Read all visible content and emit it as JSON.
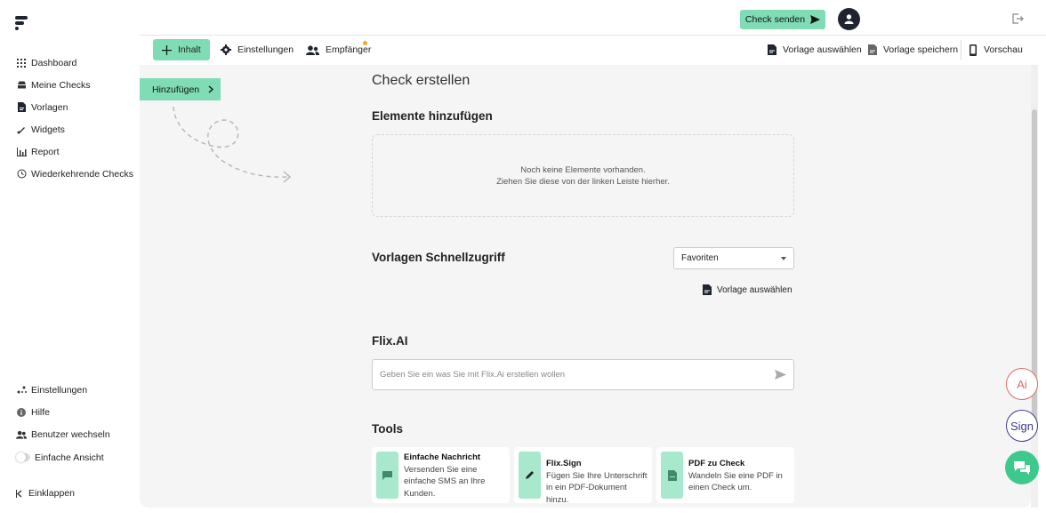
{
  "sidebar": {
    "items": [
      {
        "label": "Dashboard",
        "icon": "grid-icon"
      },
      {
        "label": "Meine Checks",
        "icon": "inbox-icon"
      },
      {
        "label": "Vorlagen",
        "icon": "document-icon"
      },
      {
        "label": "Widgets",
        "icon": "puzzle-icon"
      },
      {
        "label": "Report",
        "icon": "bar-chart-icon"
      },
      {
        "label": "Wiederkehrende Checks",
        "icon": "clock-icon"
      }
    ],
    "bottom": [
      {
        "label": "Einstellungen",
        "icon": "settings-icon"
      },
      {
        "label": "Hilfe",
        "icon": "info-icon"
      },
      {
        "label": "Benutzer wechseln",
        "icon": "users-icon"
      }
    ],
    "simple_view_label": "Einfache Ansicht",
    "collapse_label": "Einklappen"
  },
  "header": {
    "send_label": "Check senden"
  },
  "tabs": {
    "inhalt": "Inhalt",
    "einstellungen": "Einstellungen",
    "empfaenger": "Empfänger"
  },
  "toolbar": {
    "choose_template": "Vorlage auswählen",
    "save_template": "Vorlage speichern",
    "preview": "Vorschau"
  },
  "main": {
    "add_button": "Hinzufügen",
    "title": "Check erstellen",
    "elements_heading": "Elemente hinzufügen",
    "empty_line1": "Noch keine Elemente vorhanden.",
    "empty_line2": "Ziehen Sie diese von der linken Leiste hierher.",
    "quick_heading": "Vorlagen Schnellzugriff",
    "quick_select": "Favoriten",
    "quick_link": "Vorlage auswählen",
    "ai_heading": "Flix.AI",
    "ai_placeholder": "Geben Sie ein was Sie mit Flix.Ai erstellen wollen",
    "tools_heading": "Tools",
    "tools": [
      {
        "title": "Einfache Nachricht",
        "desc1": "Versenden Sie eine",
        "desc2": "einfache SMS an Ihre",
        "desc3": "Kunden."
      },
      {
        "title": "Flix.Sign",
        "desc1": "Fügen Sie Ihre Unterschrift",
        "desc2": "in ein PDF-Dokument hinzu."
      },
      {
        "title": "PDF zu Check",
        "desc1": "Wandeln Sie eine PDF in",
        "desc2": "einen Check um."
      }
    ]
  },
  "floating": {
    "ai": "Ai",
    "sign": "Sign"
  },
  "colors": {
    "accent": "#7fdcb4",
    "chat": "#3cc98b",
    "notification": "#f5a623"
  }
}
